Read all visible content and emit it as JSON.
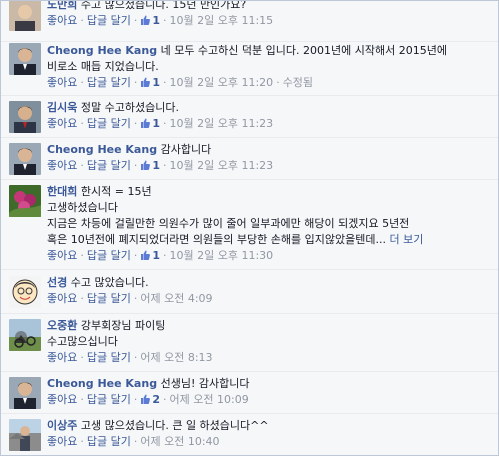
{
  "actions": {
    "like": "좋아요",
    "reply": "답글 달기",
    "more": "더 보기"
  },
  "comments": [
    {
      "author": "노만희",
      "lines": [
        "수고 많으셨습니다. 15년 만인가요?"
      ],
      "likes": "1",
      "time": "10월 2일 오후 11:15",
      "edited": ""
    },
    {
      "author": "Cheong Hee Kang",
      "lines": [
        "네 모두 수고하신 덕분 입니다. 2001년에 시작해서 2015년에",
        "비로소 매듭 지었습니다."
      ],
      "likes": "1",
      "time": "10월 2일 오후 11:20",
      "edited": "수정됨"
    },
    {
      "author": "김시욱",
      "lines": [
        "정말 수고하셨습니다."
      ],
      "likes": "1",
      "time": "10월 2일 오후 11:23",
      "edited": ""
    },
    {
      "author": "Cheong Hee Kang",
      "lines": [
        "감사합니다"
      ],
      "likes": "1",
      "time": "10월 2일 오후 11:23",
      "edited": ""
    },
    {
      "author": "한대희",
      "lines": [
        "한시적 = 15년",
        "고생하셨습니다",
        "지금은 차등에 걸릴만한 의원수가 많이 줄어 일부과에만 해당이 되겠지요 5년전",
        "혹은 10년전에 폐지되었더라면 의원들의 부당한 손해를 입지않았을텐데..."
      ],
      "likes": "1",
      "time": "10월 2일 오후 11:30",
      "edited": ""
    },
    {
      "author": "선경",
      "lines": [
        "수고 많았습니다."
      ],
      "likes": "",
      "time": "어제 오전 4:09",
      "edited": ""
    },
    {
      "author": "오중환",
      "lines": [
        "강부회장님 파이팅",
        "수고많으십니다"
      ],
      "likes": "",
      "time": "어제 오전 8:13",
      "edited": ""
    },
    {
      "author": "Cheong Hee Kang",
      "lines": [
        "선생님! 감사합니다"
      ],
      "likes": "2",
      "time": "어제 오전 10:09",
      "edited": ""
    },
    {
      "author": "이상주",
      "lines": [
        "고생 많으셨습니다. 큰 일 하셨습니다^^"
      ],
      "likes": "",
      "time": "어제 오전 10:40",
      "edited": ""
    }
  ]
}
